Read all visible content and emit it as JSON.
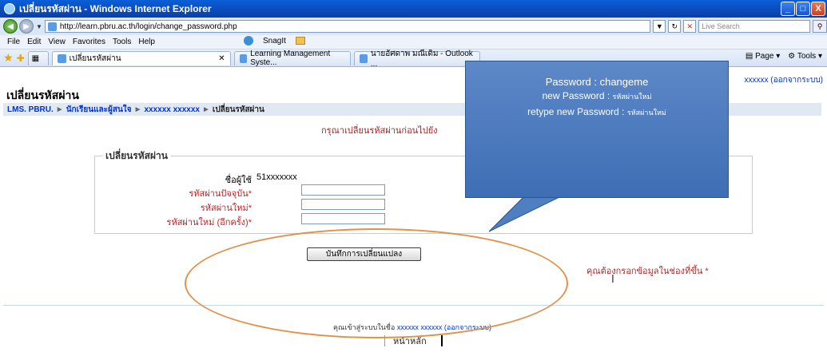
{
  "window": {
    "title": "เปลี่ยนรหัสผ่าน - Windows Internet Explorer",
    "min": "_",
    "max": "□",
    "close": "X"
  },
  "address": {
    "url": "http://learn.pbru.ac.th/login/change_password.php",
    "search_placeholder": "Live Search"
  },
  "menu": {
    "items": [
      "File",
      "Edit",
      "View",
      "Favorites",
      "Tools",
      "Help"
    ],
    "snagit": "SnagIt"
  },
  "tabs": [
    {
      "label": "เปลี่ยนรหัสผ่าน",
      "active": true
    },
    {
      "label": "Learning Management Syste...",
      "active": false
    },
    {
      "label": "นายอัศดาพ มณีเดิม - Outlook ...",
      "active": false
    }
  ],
  "toolbar": {
    "page": "Page",
    "tools": "Tools"
  },
  "page": {
    "title": "เปลี่ยนรหัสผ่าน",
    "login_info": "xxxxxx (ออกจากระบบ)",
    "breadcrumb": {
      "home": "LMS. PBRU.",
      "section": "นักเรียนและผู้สนใจ",
      "user": "xxxxxx xxxxxx",
      "current": "เปลี่ยนรหัสผ่าน"
    },
    "notice": "กรุณาเปลี่ยนรหัสผ่านก่อนไปยัง",
    "fieldset_legend": "เปลี่ยนรหัสผ่าน",
    "form": {
      "username_label": "ชื่อผู้ใช้",
      "username_value": "51xxxxxxx",
      "current_label": "รหัสผ่านปัจจุบัน*",
      "new_label": "รหัสผ่านใหม่*",
      "retype_label": "รหัสผ่านใหม่ (อีกครั้ง)*"
    },
    "save_button": "บันทึกการเปลี่ยนแปลง",
    "required_note": "คุณต้องกรอกข้อมูลในช่องที่ขึ้น *",
    "footer": {
      "login_prefix": "คุณเข้าสู่ระบบในชื่อ",
      "login_user": "xxxxxx xxxxxx",
      "logout": "(ออกจากระบบ)",
      "home": "หน้าหลัก"
    }
  },
  "callout": {
    "line1": "Password : changeme",
    "line2_label": "new Password :",
    "line2_value": "รหัสผ่านใหม่",
    "line3_label": "retype new Password :",
    "line3_value": "รหัสผ่านใหม่",
    "fill": "#4f7fc0",
    "ellipse_color": "#e0924a"
  }
}
